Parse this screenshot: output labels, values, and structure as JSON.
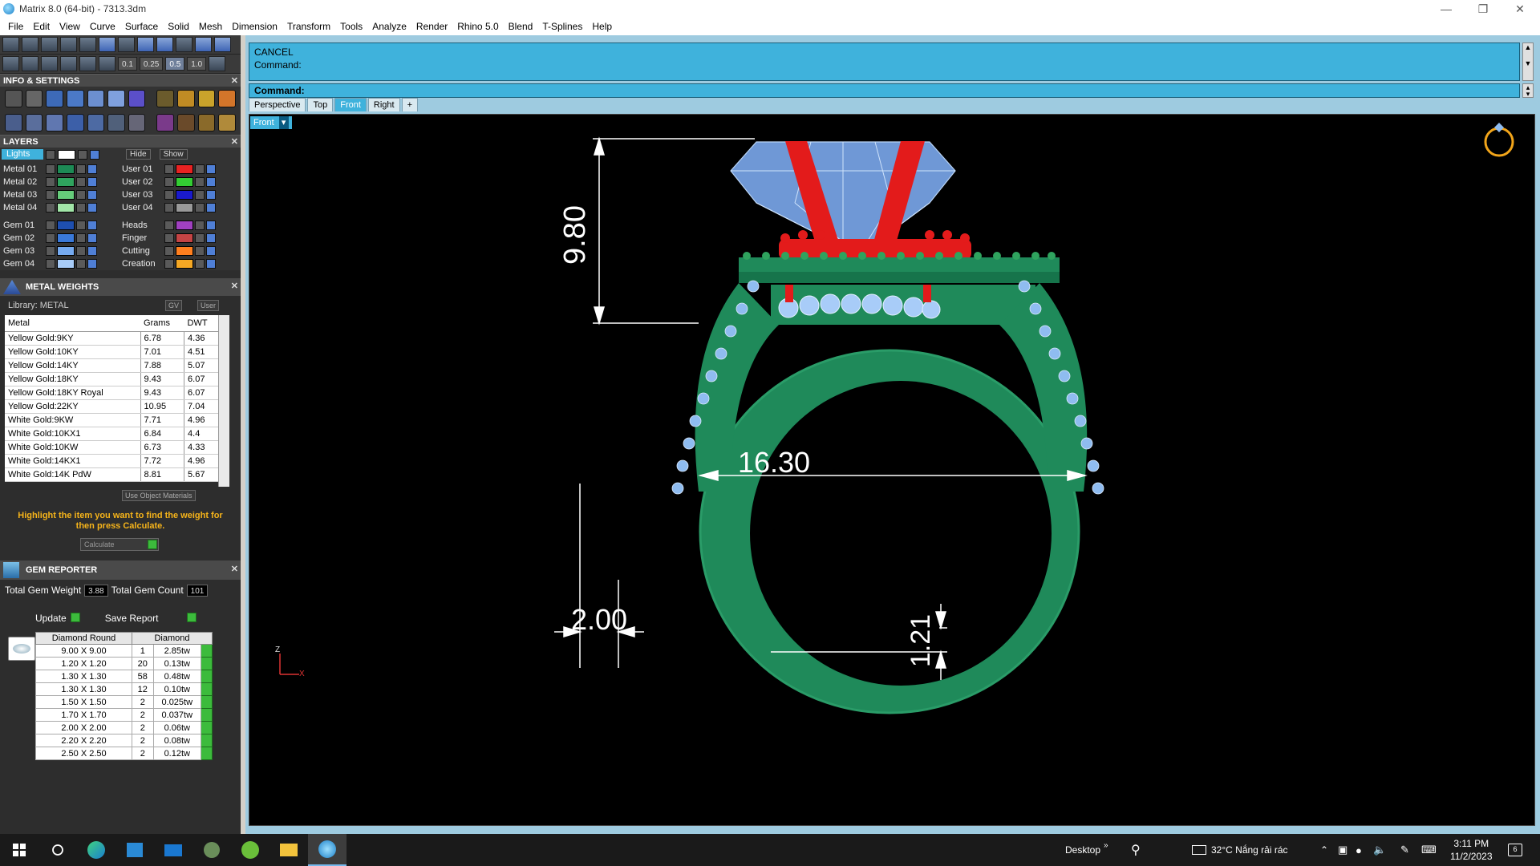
{
  "window": {
    "title": "Matrix 8.0 (64-bit) - 7313.3dm"
  },
  "menu": [
    "File",
    "Edit",
    "View",
    "Curve",
    "Surface",
    "Solid",
    "Mesh",
    "Dimension",
    "Transform",
    "Tools",
    "Analyze",
    "Render",
    "Rhino 5.0",
    "Blend",
    "T-Splines",
    "Help"
  ],
  "snap_values": [
    "0.1",
    "0.25",
    "0.5",
    "1.0"
  ],
  "info_settings": {
    "title": "INFO & SETTINGS"
  },
  "layers": {
    "title": "LAYERS",
    "lights": "Lights",
    "hide": "Hide",
    "show": "Show",
    "left": [
      {
        "name": "Metal 01",
        "color": "#1d8a55"
      },
      {
        "name": "Metal 02",
        "color": "#2fa35e"
      },
      {
        "name": "Metal 03",
        "color": "#66cc7a"
      },
      {
        "name": "Metal 04",
        "color": "#a2e6a8"
      },
      {
        "name": "Gem 01",
        "color": "#1e4fb0"
      },
      {
        "name": "Gem 02",
        "color": "#3a79d9"
      },
      {
        "name": "Gem 03",
        "color": "#75aaf0"
      },
      {
        "name": "Gem 04",
        "color": "#a8ccf8"
      }
    ],
    "right": [
      {
        "name": "User 01",
        "color": "#e82222"
      },
      {
        "name": "User 02",
        "color": "#33cc33"
      },
      {
        "name": "User 03",
        "color": "#1a1acc"
      },
      {
        "name": "User 04",
        "color": "#999999"
      },
      {
        "name": "Heads",
        "color": "#a040c0"
      },
      {
        "name": "Finger",
        "color": "#c44444"
      },
      {
        "name": "Cutting",
        "color": "#ff7f1e"
      },
      {
        "name": "Creation",
        "color": "#f6a824"
      }
    ]
  },
  "metal_weights": {
    "title": "METAL WEIGHTS",
    "library": "Library: METAL",
    "gv": "GV",
    "user": "User",
    "columns": [
      "Metal",
      "Grams",
      "DWT"
    ],
    "rows": [
      [
        "Yellow Gold:9KY",
        "6.78",
        "4.36"
      ],
      [
        "Yellow Gold:10KY",
        "7.01",
        "4.51"
      ],
      [
        "Yellow Gold:14KY",
        "7.88",
        "5.07"
      ],
      [
        "Yellow Gold:18KY",
        "9.43",
        "6.07"
      ],
      [
        "Yellow Gold:18KY Royal",
        "9.43",
        "6.07"
      ],
      [
        "Yellow Gold:22KY",
        "10.95",
        "7.04"
      ],
      [
        "White Gold:9KW",
        "7.71",
        "4.96"
      ],
      [
        "White Gold:10KX1",
        "6.84",
        "4.4"
      ],
      [
        "White Gold:10KW",
        "6.73",
        "4.33"
      ],
      [
        "White Gold:14KX1",
        "7.72",
        "4.96"
      ],
      [
        "White Gold:14K PdW",
        "8.81",
        "5.67"
      ]
    ],
    "use_object_materials": "Use Object Materials",
    "hint": "Highlight the item you want to find the weight for then press Calculate.",
    "calculate": "Calculate"
  },
  "gem_reporter": {
    "title": "GEM REPORTER",
    "total_weight_label": "Total Gem Weight",
    "total_weight": "3.88",
    "total_count_label": "Total Gem Count",
    "total_count": "101",
    "update": "Update",
    "save_report": "Save Report",
    "columns": [
      "Diamond Round",
      "Diamond"
    ],
    "rows": [
      [
        "9.00 X 9.00",
        "1",
        "2.85tw"
      ],
      [
        "1.20 X 1.20",
        "20",
        "0.13tw"
      ],
      [
        "1.30 X 1.30",
        "58",
        "0.48tw"
      ],
      [
        "1.30 X 1.30",
        "12",
        "0.10tw"
      ],
      [
        "1.50 X 1.50",
        "2",
        "0.025tw"
      ],
      [
        "1.70 X 1.70",
        "2",
        "0.037tw"
      ],
      [
        "2.00 X 2.00",
        "2",
        "0.06tw"
      ],
      [
        "2.20 X 2.20",
        "2",
        "0.08tw"
      ],
      [
        "2.50 X 2.50",
        "2",
        "0.12tw"
      ]
    ]
  },
  "command": {
    "line1": "CANCEL",
    "line2": "Command:",
    "prompt": "Command:"
  },
  "tabs": [
    "Perspective",
    "Top",
    "Front",
    "Right",
    "+"
  ],
  "active_tab": "Front",
  "view_label": "Front",
  "dimensions": {
    "top_height": "9.80",
    "inner_diameter": "16.30",
    "band_width": "2.00",
    "band_thickness": "1.21"
  },
  "axis": {
    "z": "Z",
    "x": "X"
  },
  "colors": {
    "metal": "#1f8a5a",
    "prong": "#e31b1b",
    "gem": "#8fbcf0",
    "accent": "#3fb2dc"
  },
  "taskbar": {
    "desktop": "Desktop",
    "weather": "32°C  Nắng rải rác",
    "time": "3:11 PM",
    "date": "11/2/2023",
    "notifications": "6"
  }
}
